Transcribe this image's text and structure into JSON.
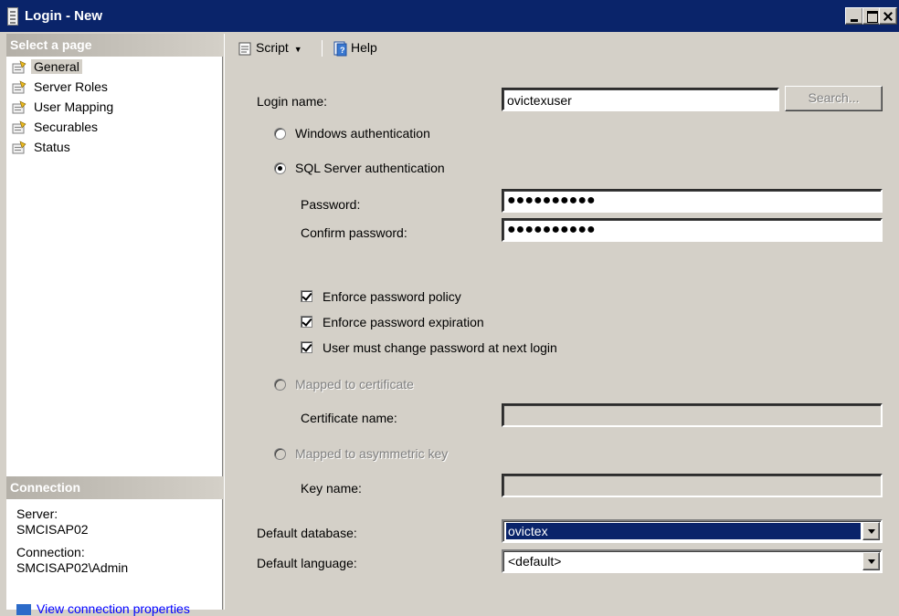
{
  "window": {
    "title": "Login - New"
  },
  "left_pane": {
    "select_page_header": "Select a page",
    "pages": [
      {
        "label": "General",
        "selected": true
      },
      {
        "label": "Server Roles",
        "selected": false
      },
      {
        "label": "User Mapping",
        "selected": false
      },
      {
        "label": "Securables",
        "selected": false
      },
      {
        "label": "Status",
        "selected": false
      }
    ],
    "connection_header": "Connection",
    "server_label": "Server:",
    "server_value": "SMCISAP02",
    "connection_label": "Connection:",
    "connection_value": "SMCISAP02\\Admin",
    "view_link_partial": "View connection properties"
  },
  "toolbar": {
    "script_label": "Script",
    "help_label": "Help"
  },
  "form": {
    "login_name_label": "Login name:",
    "login_name_value": "ovictexuser",
    "search_button": "Search...",
    "windows_auth_label": "Windows authentication",
    "sql_auth_label": "SQL Server authentication",
    "auth_mode": "sql",
    "password_label": "Password:",
    "password_value": "●●●●●●●●●●",
    "confirm_password_label": "Confirm password:",
    "confirm_password_value": "●●●●●●●●●●",
    "enforce_policy_label": "Enforce password policy",
    "enforce_policy_checked": true,
    "enforce_expiration_label": "Enforce password expiration",
    "enforce_expiration_checked": true,
    "must_change_label": "User must change password at next login",
    "must_change_checked": true,
    "mapped_cert_label": "Mapped to certificate",
    "cert_name_label": "Certificate name:",
    "cert_name_value": "",
    "mapped_asym_label": "Mapped to asymmetric key",
    "key_name_label": "Key name:",
    "key_name_value": "",
    "default_db_label": "Default database:",
    "default_db_value": "ovictex",
    "default_lang_label": "Default language:",
    "default_lang_value": "<default>"
  },
  "colors": {
    "titlebar": "#0a246a",
    "window_bg": "#d4d0c8",
    "selection": "#0a246a"
  }
}
